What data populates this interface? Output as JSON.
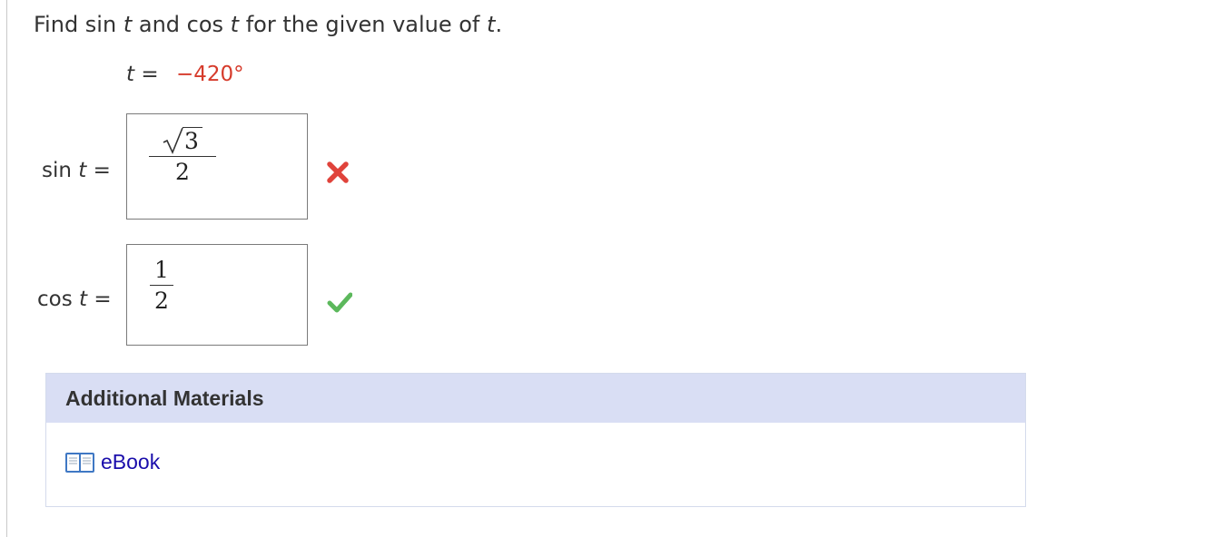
{
  "question": {
    "prompt_parts": [
      "Find sin ",
      "t",
      " and cos ",
      "t",
      " for the given value of ",
      "t",
      "."
    ],
    "given_var": "t",
    "given_eq": "=",
    "given_value": "−420°"
  },
  "answers": [
    {
      "func": "sin",
      "var": "t",
      "eq": "=",
      "numerator_radicand": "3",
      "denominator": "2",
      "status": "incorrect",
      "status_icon": "x-icon"
    },
    {
      "func": "cos",
      "var": "t",
      "eq": "=",
      "numerator": "1",
      "denominator": "2",
      "status": "correct",
      "status_icon": "checkmark-icon"
    }
  ],
  "materials": {
    "header": "Additional Materials",
    "ebook_label": "eBook",
    "ebook_icon": "book-icon"
  },
  "colors": {
    "given_value": "#d63b2b",
    "incorrect": "#e0433b",
    "correct": "#5cb85c",
    "materials_header_bg": "#d9def4",
    "link": "#1a0dab"
  }
}
